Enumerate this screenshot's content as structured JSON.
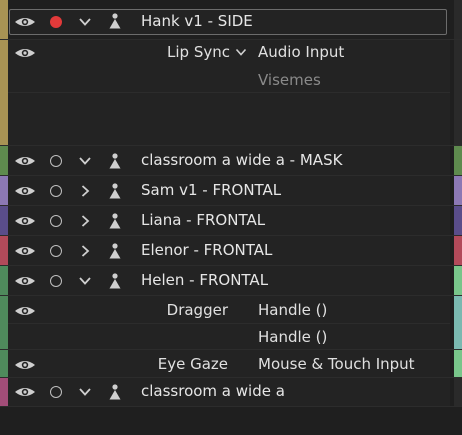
{
  "colors": {
    "background": "#1f1f1f",
    "row": "#232323",
    "record": "#e23a3a",
    "hank_label": "#a89354",
    "classroom_label": "#5e8a4e",
    "sam_label": "#8c78b4",
    "liana_label": "#5a4d8a",
    "elenor_label": "#b24a5a",
    "helen_label": "#4f8a5c",
    "classroom2_label": "#a24d78",
    "right_green": "#78c58a",
    "right_teal": "#7ab8b0"
  },
  "rows": {
    "hank": {
      "name": "Hank v1 - SIDE"
    },
    "lip_sync": {
      "prop": "Lip Sync",
      "input": "Audio Input",
      "sub": "Visemes"
    },
    "classroom_mask": {
      "name": "classroom a wide a - MASK"
    },
    "sam": {
      "name": "Sam v1 - FRONTAL"
    },
    "liana": {
      "name": "Liana - FRONTAL"
    },
    "elenor": {
      "name": "Elenor - FRONTAL"
    },
    "helen": {
      "name": "Helen - FRONTAL"
    },
    "dragger": {
      "prop": "Dragger",
      "handle1": "Handle ()",
      "handle2": "Handle ()"
    },
    "eye_gaze": {
      "prop": "Eye Gaze",
      "input": "Mouse & Touch Input"
    },
    "classroom": {
      "name": "classroom a wide a"
    }
  },
  "icons": {
    "visibility": "eye-icon",
    "record": "record-dot-icon",
    "expand": "chevron-icon",
    "puppet": "puppet-icon"
  }
}
